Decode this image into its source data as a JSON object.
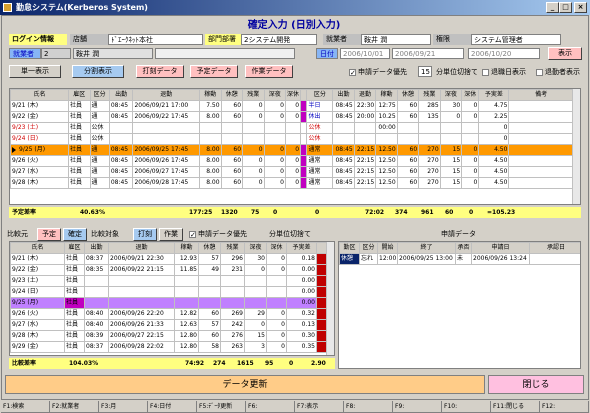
{
  "window": {
    "title": "勤怠システム(Kerberos System)",
    "min": "_",
    "max": "□",
    "close": "×"
  },
  "header": {
    "title": "確定入力 (日別入力)",
    "login_label": "ログイン情報",
    "dept_label": "店舗",
    "dept_value": "ﾄﾞｴｰｸﾈｯﾄ本社",
    "section_label": "部門部署",
    "section_value": "2システム開発",
    "emp_label": "就業者",
    "emp_value": "鞍井 潤",
    "role_label": "権限",
    "role_value": "システム管理者",
    "worker_label": "就業者",
    "worker_id": "2",
    "worker_name": "鞍井 潤",
    "date_label": "日付",
    "date_from": "2006/10/01",
    "date_mid": "2006/09/21",
    "date_to": "2006/10/20",
    "display_btn": "表示"
  },
  "toolbar": {
    "single": "単一表示",
    "split": "分割表示",
    "stamp": "打刻データ",
    "plan": "予定データ",
    "work": "作業データ",
    "opt_apply": "申請データ優先",
    "rounding_value": "15",
    "rounding_label": "分単位切捨て",
    "show_retire": "退職日表示",
    "show_leave": "退勤者表示"
  },
  "top_grid": {
    "headers": [
      "氏名",
      "雇区",
      "区分",
      "出勤",
      "退勤",
      "稼動",
      "休憩",
      "残業",
      "深夜",
      "深休",
      "区分",
      "出勤",
      "退勤",
      "稼動",
      "休憩",
      "残業",
      "深夜",
      "深休",
      "予実差",
      "備考"
    ],
    "rows": [
      {
        "date": "9/21 (木)",
        "type": "社員",
        "k": "通",
        "in": "08:45",
        "out": "2006/09/21 17:00",
        "w": "7.50",
        "r": "60",
        "o": "0",
        "n": "0",
        "nr": "0",
        "k2": "半日",
        "in2": "08:45",
        "out2": "22:30",
        "w2": "12:75",
        "r2": "60",
        "o2": "285",
        "n2": "30",
        "nr2": "0",
        "diff": "4.75"
      },
      {
        "date": "9/22 (金)",
        "type": "社員",
        "k": "通",
        "in": "08:45",
        "out": "2006/09/22 17:45",
        "w": "8.00",
        "r": "60",
        "o": "0",
        "n": "0",
        "nr": "0",
        "k2": "休出",
        "in2": "08:45",
        "out2": "20:00",
        "w2": "10.25",
        "r2": "60",
        "o2": "135",
        "n2": "0",
        "nr2": "0",
        "diff": "2.25"
      },
      {
        "date": "9/23 (土)",
        "type": "社員",
        "k": "公休",
        "in": "",
        "out": "",
        "w": "",
        "r": "",
        "o": "",
        "n": "",
        "nr": "",
        "k2": "公休",
        "in2": "",
        "out2": "",
        "w2": "00:00",
        "r2": "",
        "o2": "",
        "n2": "",
        "nr2": "",
        "diff": "0"
      },
      {
        "date": "9/24 (日)",
        "type": "社員",
        "k": "公休",
        "in": "",
        "out": "",
        "w": "",
        "r": "",
        "o": "",
        "n": "",
        "nr": "",
        "k2": "公休",
        "in2": "",
        "out2": "",
        "w2": "",
        "r2": "",
        "o2": "",
        "n2": "",
        "nr2": "",
        "diff": "0"
      },
      {
        "date": "9/25 (月)",
        "type": "社員",
        "k": "通",
        "in": "08:45",
        "out": "2006/09/25 17:45",
        "w": "8.00",
        "r": "60",
        "o": "0",
        "n": "0",
        "nr": "0",
        "k2": "通常",
        "in2": "08:45",
        "out2": "22:15",
        "w2": "12.50",
        "r2": "60",
        "o2": "270",
        "n2": "15",
        "nr2": "0",
        "diff": "4.50"
      },
      {
        "date": "9/26 (火)",
        "type": "社員",
        "k": "通",
        "in": "08:45",
        "out": "2006/09/26 17:45",
        "w": "8.00",
        "r": "60",
        "o": "0",
        "n": "0",
        "nr": "0",
        "k2": "通常",
        "in2": "08:45",
        "out2": "22:15",
        "w2": "12.50",
        "r2": "60",
        "o2": "270",
        "n2": "15",
        "nr2": "0",
        "diff": "4.50"
      },
      {
        "date": "9/27 (水)",
        "type": "社員",
        "k": "通",
        "in": "08:45",
        "out": "2006/09/27 17:45",
        "w": "8.00",
        "r": "60",
        "o": "0",
        "n": "0",
        "nr": "0",
        "k2": "通常",
        "in2": "08:45",
        "out2": "22:15",
        "w2": "12.50",
        "r2": "60",
        "o2": "270",
        "n2": "15",
        "nr2": "0",
        "diff": "4.50"
      },
      {
        "date": "9/28 (木)",
        "type": "社員",
        "k": "通",
        "in": "08:45",
        "out": "2006/09/28 17:45",
        "w": "8.00",
        "r": "60",
        "o": "0",
        "n": "0",
        "nr": "0",
        "k2": "通常",
        "in2": "08:45",
        "out2": "22:15",
        "w2": "12.50",
        "r2": "60",
        "o2": "270",
        "n2": "15",
        "nr2": "0",
        "diff": "4.50"
      }
    ]
  },
  "top_sum": {
    "label": "予定差率",
    "pct": "40.63%",
    "w": "177:25",
    "r": "1320",
    "o": "75",
    "n": "0",
    "nr": "0",
    "w2": "72:02",
    "r2": "374",
    "o2": "961",
    "n2": "60",
    "nr2": "0",
    "diff": "=105.23"
  },
  "bottom_toolbar": {
    "compare": "比較元",
    "plan": "予定",
    "confirm": "確定",
    "compare_target": "比較対象",
    "stamp": "打刻",
    "work": "作業",
    "opt_apply": "申請データ優先",
    "rounding": "分単位切捨て",
    "apply_title": "申請データ"
  },
  "bottom_grid": {
    "headers": [
      "氏名",
      "雇区",
      "出勤",
      "退勤",
      "稼動",
      "休憩",
      "残業",
      "深夜",
      "深休",
      "予実差"
    ],
    "rows": [
      {
        "date": "9/21 (木)",
        "type": "社員",
        "in": "08:37",
        "out": "2006/09/21 22:30",
        "w": "12.93",
        "r": "57",
        "o": "296",
        "n": "30",
        "nr": "0",
        "diff": "0.18"
      },
      {
        "date": "9/22 (金)",
        "type": "社員",
        "in": "08:35",
        "out": "2006/09/22 21:15",
        "w": "11.85",
        "r": "49",
        "o": "231",
        "n": "0",
        "nr": "0",
        "diff": "0.00"
      },
      {
        "date": "9/23 (土)",
        "type": "社員",
        "in": "",
        "out": "",
        "w": "",
        "r": "",
        "o": "",
        "n": "",
        "nr": "",
        "diff": "0.00"
      },
      {
        "date": "9/24 (日)",
        "type": "社員",
        "in": "",
        "out": "",
        "w": "",
        "r": "",
        "o": "",
        "n": "",
        "nr": "",
        "diff": "0.00"
      },
      {
        "date": "9/25 (月)",
        "type": "社員",
        "in": "",
        "out": "",
        "w": "",
        "r": "",
        "o": "",
        "n": "",
        "nr": "",
        "diff": "0.00"
      },
      {
        "date": "9/26 (火)",
        "type": "社員",
        "in": "08:40",
        "out": "2006/09/26 22:20",
        "w": "12.82",
        "r": "60",
        "o": "269",
        "n": "29",
        "nr": "0",
        "diff": "0.32"
      },
      {
        "date": "9/27 (水)",
        "type": "社員",
        "in": "08:40",
        "out": "2006/09/26 21:33",
        "w": "12.63",
        "r": "57",
        "o": "242",
        "n": "0",
        "nr": "0",
        "diff": "0.13"
      },
      {
        "date": "9/28 (木)",
        "type": "社員",
        "in": "08:39",
        "out": "2006/09/27 22:15",
        "w": "12.80",
        "r": "60",
        "o": "276",
        "n": "15",
        "nr": "0",
        "diff": "0.30"
      },
      {
        "date": "9/29 (金)",
        "type": "社員",
        "in": "08:37",
        "out": "2006/09/28 22:02",
        "w": "12.80",
        "r": "58",
        "o": "263",
        "n": "3",
        "nr": "0",
        "diff": "0.35"
      }
    ]
  },
  "bottom_sum": {
    "label": "比較差率",
    "pct": "104.03%",
    "w": "74:92",
    "r": "274",
    "o": "1615",
    "n": "95",
    "nr": "0",
    "diff": "2.90"
  },
  "apply_grid": {
    "headers": [
      "勤区",
      "区分",
      "開始",
      "終了",
      "承否",
      "申請日",
      "承認日"
    ],
    "rows": [
      {
        "a": "休憩",
        "b": "忘れ",
        "c": "12:00",
        "d": "2006/09/25 13:00",
        "e": "未",
        "f": "2006/09/26 13:24",
        "g": ""
      }
    ]
  },
  "actions": {
    "update": "データ更新",
    "close": "閉じる"
  },
  "fkeys": [
    "F1:検索",
    "F2:就業者",
    "F3:月",
    "F4:日付",
    "F5:ﾃﾞｰﾀ更新",
    "F6:",
    "F7:表示",
    "F8:",
    "F9:",
    "F10:",
    "F11:閉じる",
    "F12:"
  ]
}
